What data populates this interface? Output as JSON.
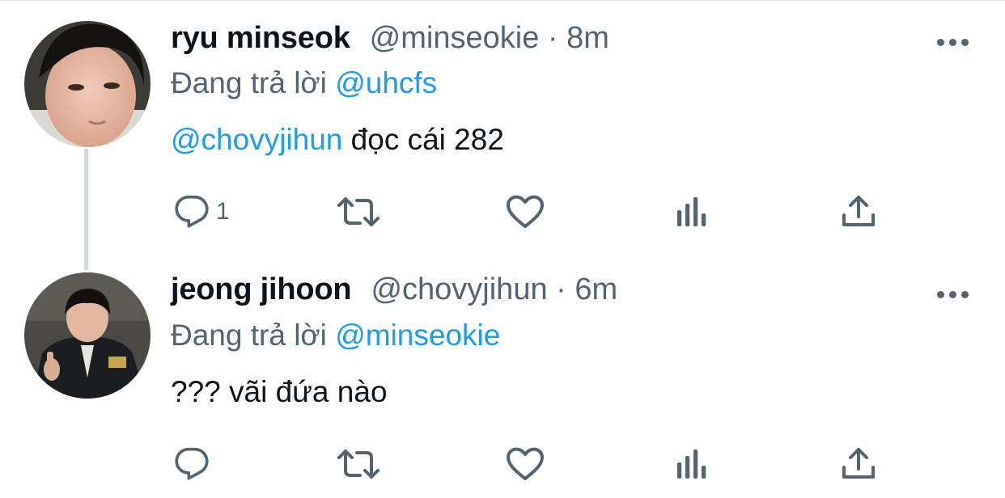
{
  "colors": {
    "text": "#0f1419",
    "secondary": "#536471",
    "mention": "#1d9bf0",
    "thread_line": "#cfd9de"
  },
  "tweets": [
    {
      "display_name": "ryu minseok",
      "meta": "@minseokie · 8m",
      "reply_prefix": "Đang trả lời",
      "reply_to": "@uhcfs",
      "text_mention": "@chovyjihun",
      "text_body": " đọc cái 282",
      "reply_count": "1",
      "icons": [
        "reply-icon",
        "retweet-icon",
        "like-icon",
        "analytics-icon",
        "share-icon"
      ]
    },
    {
      "display_name": "jeong jihoon",
      "meta": "@chovyjihun · 6m",
      "reply_prefix": "Đang trả lời",
      "reply_to": "@minseokie",
      "text_mention": "",
      "text_body": "??? vãi đứa nào",
      "reply_count": "",
      "icons": [
        "reply-icon",
        "retweet-icon",
        "like-icon",
        "analytics-icon",
        "share-icon"
      ]
    }
  ]
}
